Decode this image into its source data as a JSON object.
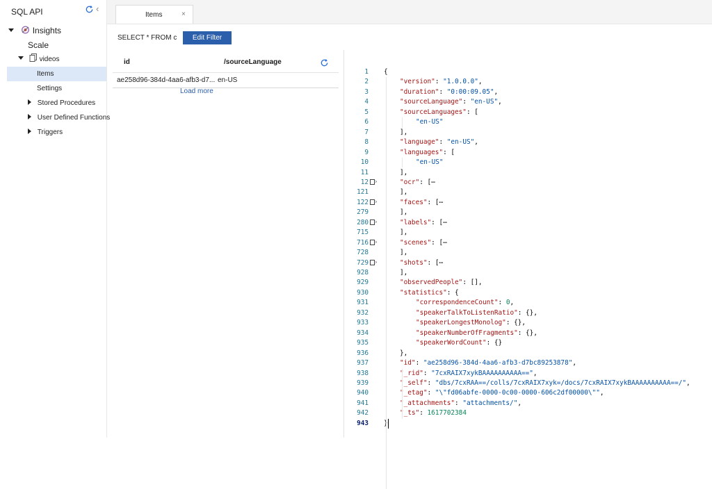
{
  "tree": {
    "header": "SQL API",
    "insights": "Insights",
    "scale": "Scale",
    "videos": "videos",
    "items": "Items",
    "settings": "Settings",
    "stored_procedures": "Stored Procedures",
    "user_defined_functions": "User Defined Functions",
    "triggers": "Triggers"
  },
  "tab": {
    "label": "Items",
    "close": "×"
  },
  "query": {
    "text": "SELECT * FROM c",
    "edit_filter": "Edit Filter"
  },
  "documents": {
    "columns": {
      "id": "id",
      "source_language": "/sourceLanguage"
    },
    "rows": [
      {
        "id": "ae258d96-384d-4aa6-afb3-d7...",
        "source_language": "en-US"
      }
    ],
    "load_more": "Load more"
  },
  "editor": {
    "current_line": "943",
    "lines": [
      {
        "n": "1",
        "indent": 0,
        "tokens": [
          [
            "p",
            "{"
          ]
        ]
      },
      {
        "n": "2",
        "indent": 1,
        "tokens": [
          [
            "k",
            "\"version\""
          ],
          [
            "p",
            ": "
          ],
          [
            "s",
            "\"1.0.0.0\""
          ],
          [
            "p",
            ","
          ]
        ]
      },
      {
        "n": "3",
        "indent": 1,
        "tokens": [
          [
            "k",
            "\"duration\""
          ],
          [
            "p",
            ": "
          ],
          [
            "s",
            "\"0:00:09.05\""
          ],
          [
            "p",
            ","
          ]
        ]
      },
      {
        "n": "4",
        "indent": 1,
        "tokens": [
          [
            "k",
            "\"sourceLanguage\""
          ],
          [
            "p",
            ": "
          ],
          [
            "s",
            "\"en-US\""
          ],
          [
            "p",
            ","
          ]
        ]
      },
      {
        "n": "5",
        "indent": 1,
        "tokens": [
          [
            "k",
            "\"sourceLanguages\""
          ],
          [
            "p",
            ": ["
          ]
        ]
      },
      {
        "n": "6",
        "indent": 2,
        "tokens": [
          [
            "s",
            "\"en-US\""
          ]
        ]
      },
      {
        "n": "7",
        "indent": 1,
        "tokens": [
          [
            "p",
            "],"
          ]
        ]
      },
      {
        "n": "8",
        "indent": 1,
        "tokens": [
          [
            "k",
            "\"language\""
          ],
          [
            "p",
            ": "
          ],
          [
            "s",
            "\"en-US\""
          ],
          [
            "p",
            ","
          ]
        ]
      },
      {
        "n": "9",
        "indent": 1,
        "tokens": [
          [
            "k",
            "\"languages\""
          ],
          [
            "p",
            ": ["
          ]
        ]
      },
      {
        "n": "10",
        "indent": 2,
        "tokens": [
          [
            "s",
            "\"en-US\""
          ]
        ]
      },
      {
        "n": "11",
        "indent": 1,
        "tokens": [
          [
            "p",
            "],"
          ]
        ]
      },
      {
        "n": "12",
        "indent": 1,
        "fold": true,
        "tokens": [
          [
            "k",
            "\"ocr\""
          ],
          [
            "p",
            ": [⋯"
          ]
        ]
      },
      {
        "n": "121",
        "indent": 1,
        "tokens": [
          [
            "p",
            "],"
          ]
        ]
      },
      {
        "n": "122",
        "indent": 1,
        "fold": true,
        "tokens": [
          [
            "k",
            "\"faces\""
          ],
          [
            "p",
            ": [⋯"
          ]
        ]
      },
      {
        "n": "279",
        "indent": 1,
        "tokens": [
          [
            "p",
            "],"
          ]
        ]
      },
      {
        "n": "280",
        "indent": 1,
        "fold": true,
        "tokens": [
          [
            "k",
            "\"labels\""
          ],
          [
            "p",
            ": [⋯"
          ]
        ]
      },
      {
        "n": "715",
        "indent": 1,
        "tokens": [
          [
            "p",
            "],"
          ]
        ]
      },
      {
        "n": "716",
        "indent": 1,
        "fold": true,
        "tokens": [
          [
            "k",
            "\"scenes\""
          ],
          [
            "p",
            ": [⋯"
          ]
        ]
      },
      {
        "n": "728",
        "indent": 1,
        "tokens": [
          [
            "p",
            "],"
          ]
        ]
      },
      {
        "n": "729",
        "indent": 1,
        "fold": true,
        "tokens": [
          [
            "k",
            "\"shots\""
          ],
          [
            "p",
            ": [⋯"
          ]
        ]
      },
      {
        "n": "928",
        "indent": 1,
        "tokens": [
          [
            "p",
            "],"
          ]
        ]
      },
      {
        "n": "929",
        "indent": 1,
        "tokens": [
          [
            "k",
            "\"observedPeople\""
          ],
          [
            "p",
            ": [],"
          ]
        ]
      },
      {
        "n": "930",
        "indent": 1,
        "tokens": [
          [
            "k",
            "\"statistics\""
          ],
          [
            "p",
            ": {"
          ]
        ]
      },
      {
        "n": "931",
        "indent": 2,
        "tokens": [
          [
            "k",
            "\"correspondenceCount\""
          ],
          [
            "p",
            ": "
          ],
          [
            "n",
            "0"
          ],
          [
            "p",
            ","
          ]
        ]
      },
      {
        "n": "932",
        "indent": 2,
        "tokens": [
          [
            "k",
            "\"speakerTalkToListenRatio\""
          ],
          [
            "p",
            ": {},"
          ]
        ]
      },
      {
        "n": "933",
        "indent": 2,
        "tokens": [
          [
            "k",
            "\"speakerLongestMonolog\""
          ],
          [
            "p",
            ": {},"
          ]
        ]
      },
      {
        "n": "934",
        "indent": 2,
        "tokens": [
          [
            "k",
            "\"speakerNumberOfFragments\""
          ],
          [
            "p",
            ": {},"
          ]
        ]
      },
      {
        "n": "935",
        "indent": 2,
        "tokens": [
          [
            "k",
            "\"speakerWordCount\""
          ],
          [
            "p",
            ": {}"
          ]
        ]
      },
      {
        "n": "936",
        "indent": 1,
        "tokens": [
          [
            "p",
            "},"
          ]
        ]
      },
      {
        "n": "937",
        "indent": 1,
        "tokens": [
          [
            "k",
            "\"id\""
          ],
          [
            "p",
            ": "
          ],
          [
            "s",
            "\"ae258d96-384d-4aa6-afb3-d7bc89253878\""
          ],
          [
            "p",
            ","
          ]
        ]
      },
      {
        "n": "938",
        "indent": 1,
        "tokens": [
          [
            "k",
            "\"_rid\""
          ],
          [
            "p",
            ": "
          ],
          [
            "s",
            "\"7cxRAIX7xykBAAAAAAAAAA==\""
          ],
          [
            "p",
            ","
          ]
        ]
      },
      {
        "n": "939",
        "indent": 1,
        "tokens": [
          [
            "k",
            "\"_self\""
          ],
          [
            "p",
            ": "
          ],
          [
            "s",
            "\"dbs/7cxRAA==/colls/7cxRAIX7xyk=/docs/7cxRAIX7xykBAAAAAAAAAA==/\""
          ],
          [
            "p",
            ","
          ]
        ]
      },
      {
        "n": "940",
        "indent": 1,
        "tokens": [
          [
            "k",
            "\"_etag\""
          ],
          [
            "p",
            ": "
          ],
          [
            "s",
            "\"\\\"fd06abfe-0000-0c00-0000-606c2df00000\\\"\""
          ],
          [
            "p",
            ","
          ]
        ]
      },
      {
        "n": "941",
        "indent": 1,
        "tokens": [
          [
            "k",
            "\"_attachments\""
          ],
          [
            "p",
            ": "
          ],
          [
            "s",
            "\"attachments/\""
          ],
          [
            "p",
            ","
          ]
        ]
      },
      {
        "n": "942",
        "indent": 1,
        "tokens": [
          [
            "k",
            "\"_ts\""
          ],
          [
            "p",
            ": "
          ],
          [
            "n",
            "1617702384"
          ]
        ]
      },
      {
        "n": "943",
        "indent": 0,
        "tokens": [
          [
            "p",
            "}"
          ]
        ]
      }
    ]
  },
  "icons": {
    "tree_refresh": "refresh-icon",
    "collapse": "chevron-left-icon",
    "insights": "insights-icon",
    "collection": "collection-icon",
    "list_refresh": "refresh-icon"
  },
  "colors": {
    "accent": "#2b5eab",
    "selected": "#dce8f7",
    "json_key": "#a31515",
    "json_string": "#0451a5",
    "json_number": "#098658"
  }
}
